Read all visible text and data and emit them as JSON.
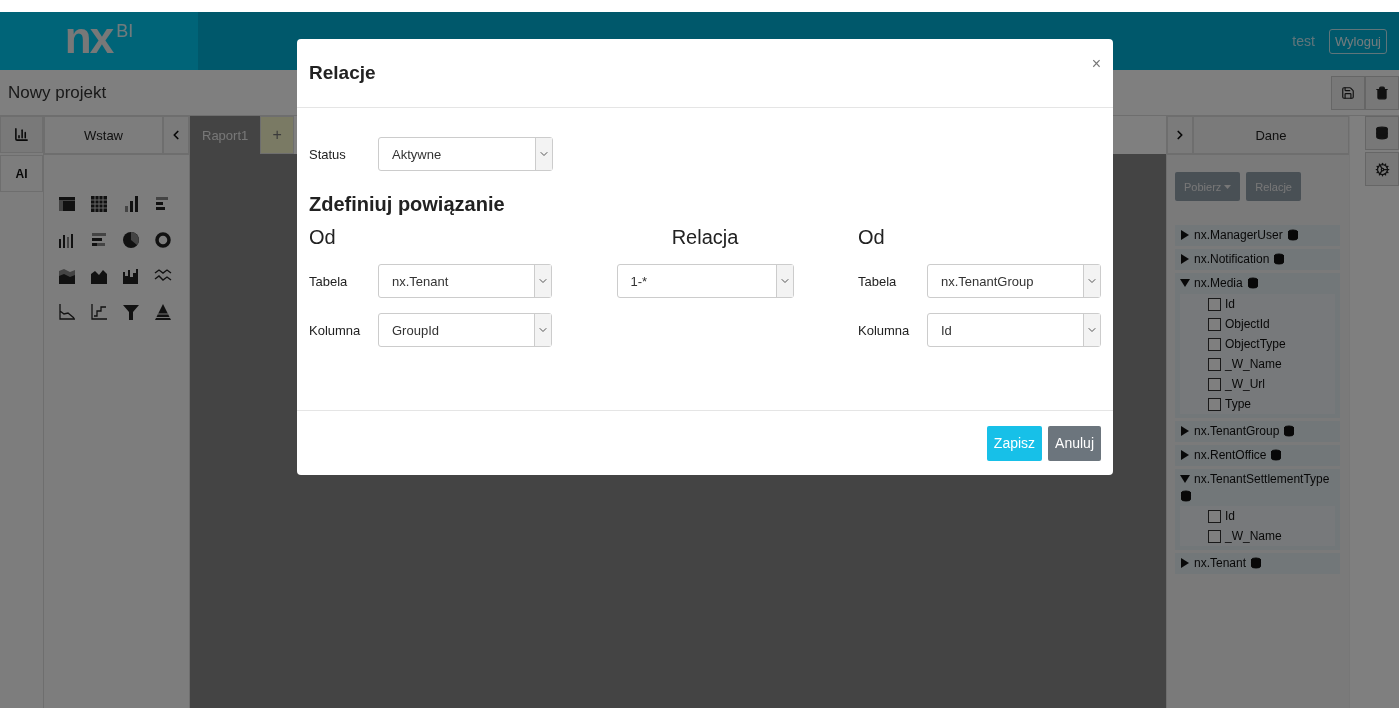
{
  "header": {
    "logo_text": "nx",
    "logo_suffix": "BI",
    "user": "test",
    "logout": "Wyloguj"
  },
  "project": {
    "title": "Nowy projekt"
  },
  "left_tabs": [
    {
      "kind": "icon"
    },
    {
      "kind": "text",
      "label": "AI"
    }
  ],
  "insert_panel": {
    "title": "Wstaw"
  },
  "report_tabs": [
    {
      "label": "Raport1",
      "selected": true
    }
  ],
  "add_tab": "+",
  "data_panel": {
    "title": "Dane",
    "buttons": [
      {
        "label": "Pobierz",
        "kind": "dropdown"
      },
      {
        "label": "Relacje",
        "kind": "plain"
      }
    ],
    "tables": [
      {
        "name": "nx.ManagerUser",
        "expanded": false
      },
      {
        "name": "nx.Notification",
        "expanded": false
      },
      {
        "name": "nx.Media",
        "expanded": true,
        "children": [
          {
            "name": "Id",
            "checked": false
          },
          {
            "name": "ObjectId",
            "checked": false
          },
          {
            "name": "ObjectType",
            "checked": false
          },
          {
            "name": "_W_Name",
            "checked": false
          },
          {
            "name": "_W_Url",
            "checked": false
          },
          {
            "name": "Type",
            "checked": false
          }
        ]
      },
      {
        "name": "nx.TenantGroup",
        "expanded": false
      },
      {
        "name": "nx.RentOffice",
        "expanded": false
      },
      {
        "name": "nx.TenantSettlementType",
        "expanded": true,
        "children": [
          {
            "name": "Id",
            "checked": false
          },
          {
            "name": "_W_Name",
            "checked": false
          }
        ]
      },
      {
        "name": "nx.Tenant",
        "expanded": false
      }
    ]
  },
  "modal": {
    "title": "Relacje",
    "close": "×",
    "status_label": "Status",
    "status_value": "Aktywne",
    "section_title": "Zdefiniuj powiązanie",
    "left": {
      "heading": "Od",
      "table_label": "Tabela",
      "table_value": "nx.Tenant",
      "column_label": "Kolumna",
      "column_value": "GroupId"
    },
    "relation": {
      "heading": "Relacja",
      "value": "1-*"
    },
    "right": {
      "heading": "Od",
      "table_label": "Tabela",
      "table_value": "nx.TenantGroup",
      "column_label": "Kolumna",
      "column_value": "Id"
    },
    "buttons": [
      {
        "label": "Zapisz",
        "kind": "primary"
      },
      {
        "label": "Anuluj",
        "kind": "secondary"
      }
    ]
  }
}
